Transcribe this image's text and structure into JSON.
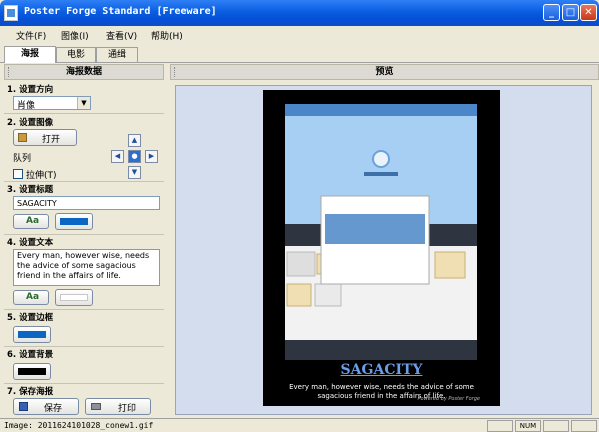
{
  "window": {
    "title": "Poster Forge Standard [Freeware]",
    "minimize": "_",
    "maximize": "□",
    "close": "✕"
  },
  "menu": [
    "文件(F)",
    "图像(I)",
    "查看(V)",
    "帮助(H)"
  ],
  "tabs": [
    "海报",
    "电影",
    "通缉"
  ],
  "left_panel": {
    "header": "海报数据",
    "s1": {
      "title": "1. 设置方向",
      "value": "肖像"
    },
    "s2": {
      "title": "2. 设置图像",
      "open": "打开",
      "queue": "队列",
      "stretch": "拉伸(T)"
    },
    "s3": {
      "title": "3. 设置标题",
      "value": "SAGACITY",
      "color": "#0a66c2"
    },
    "s4": {
      "title": "4. 设置文本",
      "value": "Every man, however wise, needs the advice of some sagacious friend in the affairs of life.",
      "color": "#ffffff"
    },
    "s5": {
      "title": "5. 设置边框",
      "color": "#0a66c2"
    },
    "s6": {
      "title": "6. 设置背景",
      "color": "#000000"
    },
    "s7": {
      "title": "7. 保存海报",
      "save": "保存",
      "print": "打印"
    }
  },
  "right_panel": {
    "header": "预览",
    "poster": {
      "title": "SAGACITY",
      "text": "Every man, however wise, needs the advice of some sagacious friend in the affairs of life.",
      "credit": "Powered by Poster Forge"
    }
  },
  "status": {
    "text": "Image: 2011624101028_conew1.gif",
    "num": "NUM"
  }
}
